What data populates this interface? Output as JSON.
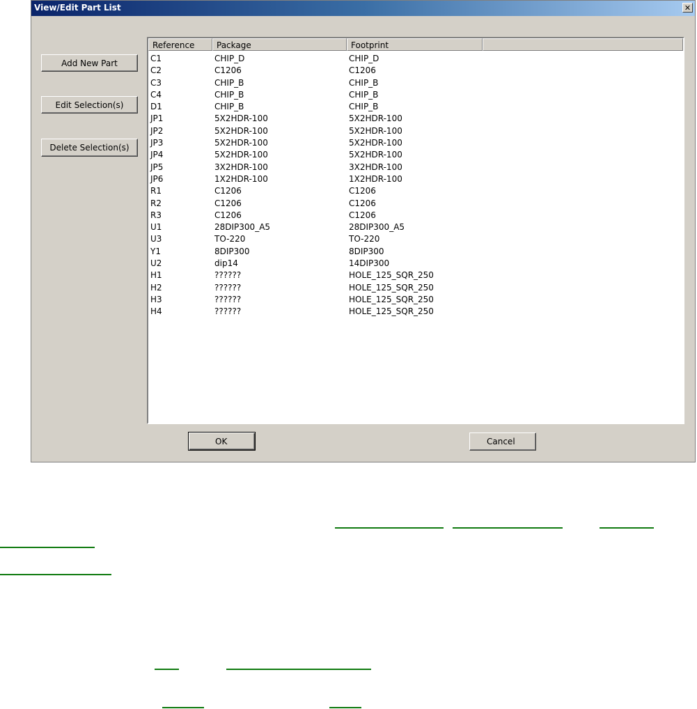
{
  "window": {
    "title": "View/Edit Part List",
    "close_glyph": "✕"
  },
  "side_buttons": {
    "add": "Add New Part",
    "edit": "Edit Selection(s)",
    "delete": "Delete Selection(s)"
  },
  "list": {
    "columns": [
      "Reference",
      "Package",
      "Footprint",
      ""
    ],
    "rows": [
      [
        "C1",
        "CHIP_D",
        "CHIP_D"
      ],
      [
        "C2",
        "C1206",
        "C1206"
      ],
      [
        "C3",
        "CHIP_B",
        "CHIP_B"
      ],
      [
        "C4",
        "CHIP_B",
        "CHIP_B"
      ],
      [
        "D1",
        "CHIP_B",
        "CHIP_B"
      ],
      [
        "JP1",
        "5X2HDR-100",
        "5X2HDR-100"
      ],
      [
        "JP2",
        "5X2HDR-100",
        "5X2HDR-100"
      ],
      [
        "JP3",
        "5X2HDR-100",
        "5X2HDR-100"
      ],
      [
        "JP4",
        "5X2HDR-100",
        "5X2HDR-100"
      ],
      [
        "JP5",
        "3X2HDR-100",
        "3X2HDR-100"
      ],
      [
        "JP6",
        "1X2HDR-100",
        "1X2HDR-100"
      ],
      [
        "R1",
        "C1206",
        "C1206"
      ],
      [
        "R2",
        "C1206",
        "C1206"
      ],
      [
        "R3",
        "C1206",
        "C1206"
      ],
      [
        "U1",
        "28DIP300_A5",
        "28DIP300_A5"
      ],
      [
        "U3",
        "TO-220",
        "TO-220"
      ],
      [
        "Y1",
        "8DIP300",
        "8DIP300"
      ],
      [
        "U2",
        "dip14",
        "14DIP300"
      ],
      [
        "H1",
        "??????",
        "HOLE_125_SQR_250"
      ],
      [
        "H2",
        "??????",
        "HOLE_125_SQR_250"
      ],
      [
        "H3",
        "??????",
        "HOLE_125_SQR_250"
      ],
      [
        "H4",
        "??????",
        "HOLE_125_SQR_250"
      ]
    ]
  },
  "dialog_buttons": {
    "ok": "OK",
    "cancel": "Cancel"
  },
  "colors": {
    "title_start": "#0a246a",
    "title_end": "#a6caf0",
    "dialog_bg": "#d4d0c8",
    "link_underline": "#0f7a0f"
  }
}
